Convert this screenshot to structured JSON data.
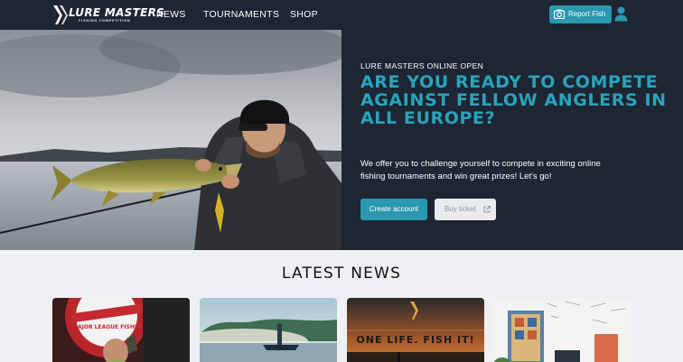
{
  "brand": {
    "name": "LURE MASTERS",
    "tagline": "FISHING COMPETITION"
  },
  "nav": {
    "items": [
      {
        "label": "NEWS"
      },
      {
        "label": "TOURNAMENTS"
      },
      {
        "label": "SHOP"
      }
    ]
  },
  "header_actions": {
    "report_label": "Report Fish"
  },
  "hero": {
    "eyebrow": "LURE MASTERS ONLINE OPEN",
    "headline": "ARE YOU READY TO COMPETE AGAINST FELLOW ANGLERS IN ALL EUROPE?",
    "subline": "We offer you to challenge yourself to compete in exciting online fishing tournaments and win great prizes! Let's go!",
    "primary_cta": "Create account",
    "secondary_cta": "Buy ticket"
  },
  "news": {
    "title": "LATEST NEWS",
    "cards": [
      {
        "image": "angler-holding-fish-photo",
        "overlay_text": "MAJOR LEAGUE FISHING"
      },
      {
        "image": "boat-on-misty-lake-photo",
        "overlay_text": ""
      },
      {
        "image": "sunset-fishing-poster",
        "overlay_text": "ONE LIFE. FISH IT!"
      },
      {
        "image": "office-wall-photo",
        "overlay_text": ""
      }
    ]
  },
  "colors": {
    "header_bg": "#1d2632",
    "accent": "#2a98b0",
    "headline": "#2aa3bd",
    "page_bg": "#eef0f3"
  }
}
